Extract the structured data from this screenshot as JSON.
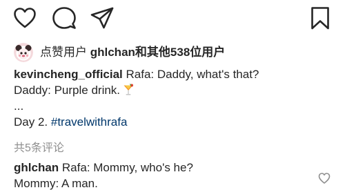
{
  "actions": {
    "like_icon": "heart-outline",
    "comment_icon": "speech-bubble",
    "share_icon": "paper-plane",
    "save_icon": "bookmark"
  },
  "likes": {
    "prefix": "点赞用户",
    "user": "ghlchan",
    "suffix": "和其他538位用户"
  },
  "caption": {
    "username": "kevincheng_official",
    "line1_text": "Rafa: Daddy, what's that?",
    "line2_text": "Daddy: Purple drink.",
    "line2_emoji": "tropical-drink",
    "line3_text": "...",
    "line4_text": "Day 2.",
    "hashtag": "#travelwithrafa"
  },
  "comments": {
    "view_all_label": "共5条评论",
    "first": {
      "username": "ghlchan",
      "line1_text": "Rafa: Mommy, who's he?",
      "line2_text": "Mommy: A man."
    }
  },
  "colors": {
    "text": "#262626",
    "muted": "#8e8e8e",
    "link": "#00376b"
  }
}
